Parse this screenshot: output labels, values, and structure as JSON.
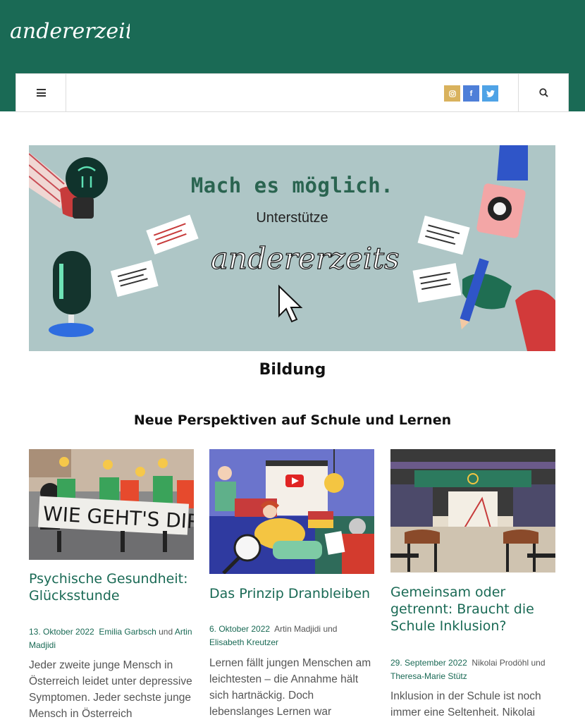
{
  "header": {
    "logo_text": "andererzeits",
    "social": [
      {
        "name": "instagram",
        "icon": "instagram-icon",
        "color": "#d9b25d"
      },
      {
        "name": "facebook",
        "icon": "facebook-icon",
        "label": "f",
        "color": "#4e7fd8"
      },
      {
        "name": "twitter",
        "icon": "twitter-icon",
        "color": "#4fa3e6"
      }
    ],
    "brand_color": "#1a6a55"
  },
  "banner": {
    "headline": "Mach es möglich.",
    "subline": "Unterstütze",
    "logo_text": "andererzeits",
    "background": "#aec6c6"
  },
  "section": {
    "title": "Bildung",
    "subtitle": "Neue Perspektiven auf Schule und Lernen"
  },
  "articles": [
    {
      "image_caption": "WIE GEHT'S DIR?",
      "title": "Psychische Gesundheit: Glücksstunde",
      "date": "13. Oktober 2022",
      "author1": "Emilia Garbsch",
      "conj": "und",
      "author2": "Artin Madjidi",
      "excerpt": "Jeder zweite junge Mensch in Österreich leidet unter depressive Symptomen. Jeder sechste junge Mensch in Österreich"
    },
    {
      "title": "Das Prinzip Dranbleiben",
      "date": "6. Oktober 2022",
      "author1": "Artin Madjidi",
      "conj": "und",
      "author2": "Elisabeth Kreutzer",
      "excerpt": "Lernen fällt jungen Menschen am leichtesten – die Annahme hält sich hartnäckig. Doch lebenslanges Lernen war"
    },
    {
      "title": "Gemeinsam oder getrennt: Braucht die Schule Inklusion?",
      "date": "29. September 2022",
      "author1": "Nikolai Prodöhl",
      "conj": "und",
      "author2": "Theresa-Marie Stütz",
      "excerpt": "Inklusion in der Schule ist noch immer eine Seltenheit. Nikolai und"
    }
  ]
}
